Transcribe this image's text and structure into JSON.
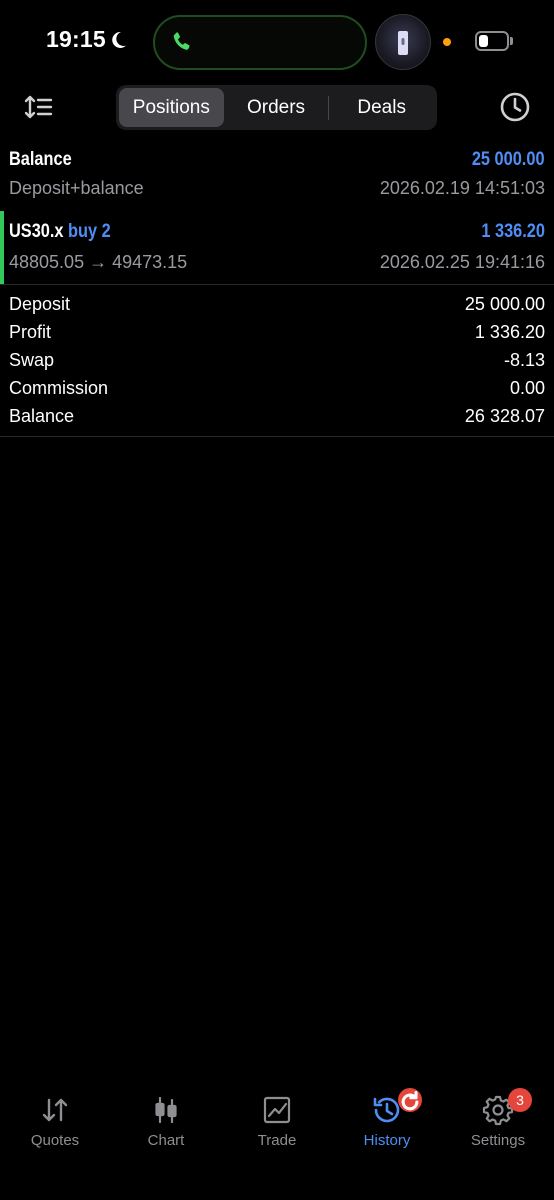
{
  "status_bar": {
    "time": "19:15",
    "battery_level": 0.35
  },
  "toolbar": {
    "tabs": [
      {
        "label": "Positions",
        "active": true
      },
      {
        "label": "Orders",
        "active": false
      },
      {
        "label": "Deals",
        "active": false
      }
    ]
  },
  "history": [
    {
      "title": "Balance",
      "subtitle": "Deposit+balance",
      "amount": "25 000.00",
      "datetime": "2026.02.19 14:51:03"
    },
    {
      "symbol": "US30.x",
      "side": "buy 2",
      "open_price": "48805.05",
      "arrow": "→",
      "close_price": "49473.15",
      "amount": "1 336.20",
      "datetime": "2026.02.25 19:41:16"
    }
  ],
  "summary": [
    {
      "label": "Deposit",
      "value": "25 000.00"
    },
    {
      "label": "Profit",
      "value": "1 336.20"
    },
    {
      "label": "Swap",
      "value": "-8.13"
    },
    {
      "label": "Commission",
      "value": "0.00"
    },
    {
      "label": "Balance",
      "value": "26 328.07"
    }
  ],
  "tab_bar": {
    "items": [
      {
        "label": "Quotes",
        "icon": "quotes-icon",
        "active": false
      },
      {
        "label": "Chart",
        "icon": "chart-icon",
        "active": false
      },
      {
        "label": "Trade",
        "icon": "trade-icon",
        "active": false
      },
      {
        "label": "History",
        "icon": "history-icon",
        "active": true
      },
      {
        "label": "Settings",
        "icon": "settings-icon",
        "active": false,
        "badge": "3"
      }
    ]
  },
  "colors": {
    "accent": "#4f8ef5",
    "positive_bar": "#34c759",
    "badge": "#e5453a"
  }
}
